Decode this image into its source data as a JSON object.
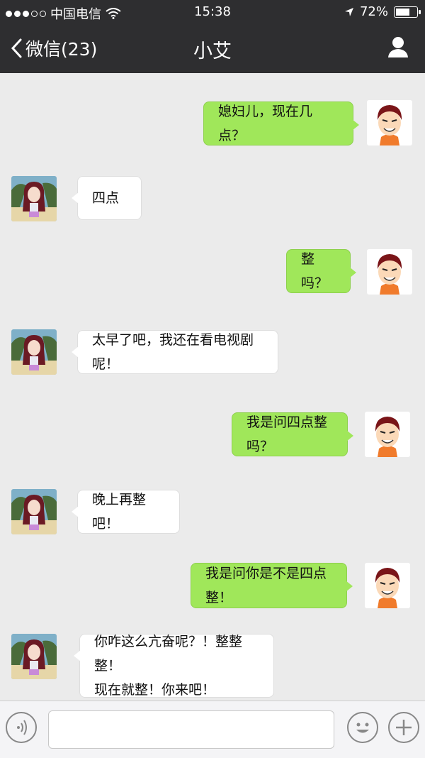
{
  "status_bar": {
    "carrier": "中国电信",
    "time": "15:38",
    "battery_percent": "72%",
    "battery_level": 0.72
  },
  "nav": {
    "back_label": "微信(23)",
    "title": "小艾"
  },
  "messages": [
    {
      "sender": "me",
      "text": "媳妇儿，现在几点？"
    },
    {
      "sender": "her",
      "text": "四点"
    },
    {
      "sender": "me",
      "text": "整吗？"
    },
    {
      "sender": "her",
      "text": "太早了吧，我还在看电视剧呢！"
    },
    {
      "sender": "me",
      "text": "我是问四点整吗？"
    },
    {
      "sender": "her",
      "text": "晚上再整吧！"
    },
    {
      "sender": "me",
      "text": "我是问你是不是四点整！"
    },
    {
      "sender": "her",
      "lines": [
        "你咋这么亢奋呢？！整整整！",
        "现在就整！你来吧！"
      ]
    }
  ],
  "colors": {
    "nav_bg": "#2e2e30",
    "chat_bg": "#ebebeb",
    "me_bubble": "#a0e75a",
    "her_bubble": "#ffffff"
  },
  "icons": {
    "back": "chevron-left-icon",
    "contact": "person-icon",
    "voice": "voice-icon",
    "emoji": "emoji-icon",
    "more": "plus-icon"
  }
}
